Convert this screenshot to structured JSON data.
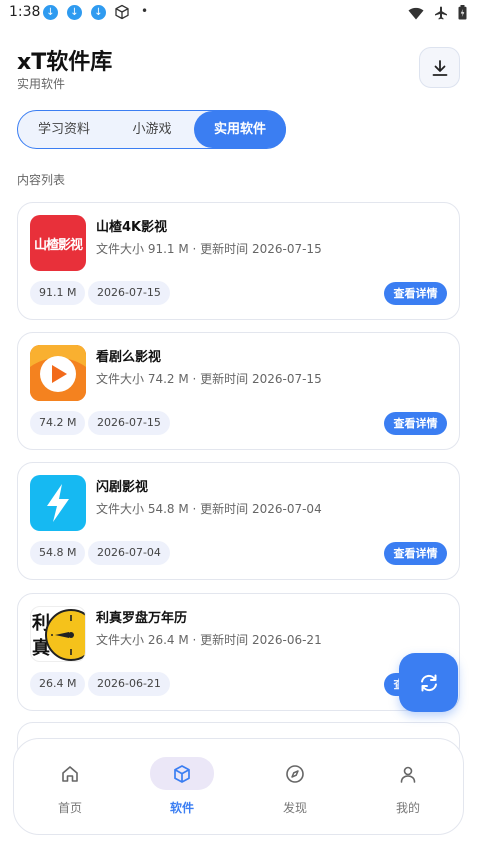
{
  "status_bar": {
    "time": "1:38",
    "dot": "•"
  },
  "header": {
    "title": "xT软件库",
    "subtitle": "实用软件"
  },
  "tabs": [
    {
      "label": "学习资料",
      "active": false
    },
    {
      "label": "小游戏",
      "active": false
    },
    {
      "label": "实用软件",
      "active": true
    }
  ],
  "section_label": "内容列表",
  "apps": [
    {
      "name": "山楂4K影视",
      "meta": "文件大小 91.1 M · 更新时间 2026-07-15",
      "size_chip": "91.1 M",
      "date_chip": "2026-07-15",
      "button": "查看详情",
      "icon_text": "山楂影视",
      "icon_name": "shanzha-app-icon",
      "icon_color": "#e8303a"
    },
    {
      "name": "看剧么影视",
      "meta": "文件大小 74.2 M · 更新时间 2026-07-15",
      "size_chip": "74.2 M",
      "date_chip": "2026-07-15",
      "button": "查看详情",
      "icon_name": "play-app-icon",
      "icon_color": "#f26a1b"
    },
    {
      "name": "闪剧影视",
      "meta": "文件大小 54.8 M · 更新时间 2026-07-04",
      "size_chip": "54.8 M",
      "date_chip": "2026-07-04",
      "button": "查看详情",
      "icon_name": "lightning-app-icon",
      "icon_color": "#16b9f2"
    },
    {
      "name": "利真罗盘万年历",
      "meta": "文件大小 26.4 M · 更新时间 2026-06-21",
      "size_chip": "26.4 M",
      "date_chip": "2026-06-21",
      "button": "查看详情",
      "icon_text_1": "利",
      "icon_text_2": "真",
      "icon_name": "compass-app-icon",
      "icon_color": "#f5c21b"
    }
  ],
  "bottom_nav": [
    {
      "label": "首页",
      "icon": "home-icon",
      "active": false
    },
    {
      "label": "软件",
      "icon": "cube-icon",
      "active": true
    },
    {
      "label": "发现",
      "icon": "compass-icon",
      "active": false
    },
    {
      "label": "我的",
      "icon": "person-icon",
      "active": false
    }
  ],
  "colors": {
    "accent": "#3b7ef2",
    "chip_bg": "#eef1fb",
    "nav_active_bg": "#ebe7f7"
  }
}
